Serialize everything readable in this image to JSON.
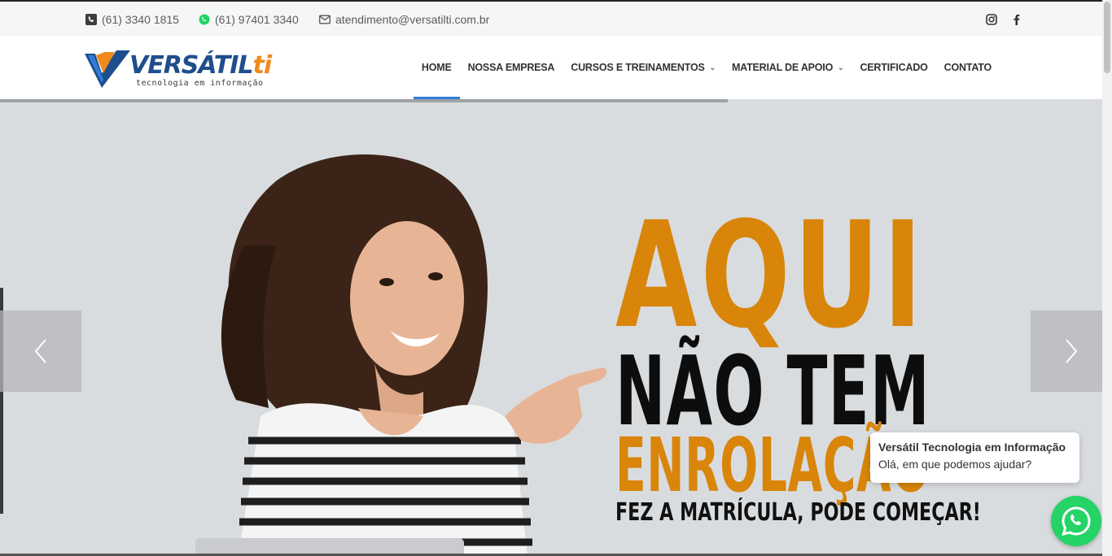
{
  "topbar": {
    "phone": "(61) 3340 1815",
    "whatsapp": "(61) 97401 3340",
    "email": "atendimento@versatilti.com.br",
    "social": [
      "instagram-icon",
      "facebook-icon"
    ]
  },
  "brand": {
    "name_main": "VERSÁTIL",
    "name_accent": "ti",
    "tagline": "tecnologia em informação",
    "colors": {
      "blue": "#1f4e8c",
      "orange": "#f08a1c"
    }
  },
  "nav": {
    "items": [
      {
        "label": "HOME",
        "active": true
      },
      {
        "label": "NOSSA EMPRESA"
      },
      {
        "label": "CURSOS E TREINAMENTOS",
        "dropdown": true
      },
      {
        "label": "MATERIAL DE APOIO",
        "dropdown": true
      },
      {
        "label": "CERTIFICADO"
      },
      {
        "label": "CONTATO"
      }
    ],
    "accent": "#2f7dd9"
  },
  "hero": {
    "line1": "AQUI",
    "line2": "NÃO TEM",
    "line3": "ENROLAÇÃO",
    "line4": "FEZ A MATRÍCULA, PODE COMEÇAR!",
    "colors": {
      "orange": "#d8850a",
      "black": "#0d0d0d"
    }
  },
  "whatsapp_widget": {
    "title": "Versátil Tecnologia em Informação",
    "message": "Olá, em que podemos ajudar?",
    "color": "#25d366"
  }
}
